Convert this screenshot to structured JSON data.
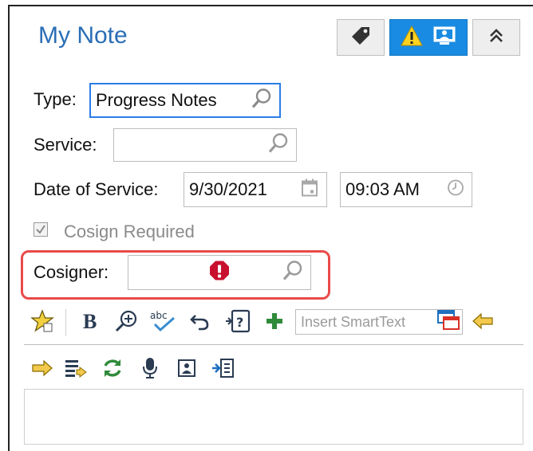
{
  "header": {
    "title": "My Note",
    "buttons": [
      {
        "icon": "tag-icon",
        "active": false
      },
      {
        "icon": "warning-monitor-icon",
        "active": true
      },
      {
        "icon": "chevrons-up-icon",
        "active": false
      }
    ]
  },
  "form": {
    "type_label": "Type:",
    "type_value": "Progress Notes",
    "service_label": "Service:",
    "service_value": "",
    "date_label": "Date of Service:",
    "date_value": "9/30/2021",
    "time_value": "09:03 AM",
    "cosign_required_label": "Cosign Required",
    "cosign_required_checked": true,
    "cosigner_label": "Cosigner:",
    "cosigner_value": ""
  },
  "toolbar": {
    "smarttext_placeholder": "Insert SmartText",
    "row1_icons": [
      "favorite-star-icon",
      "bold-icon",
      "zoom-in-icon",
      "spellcheck-icon",
      "undo-icon",
      "insert-field-icon",
      "add-plus-icon",
      "smarttext-panel-icon",
      "arrow-left-icon"
    ],
    "row2_icons": [
      "arrow-right-icon",
      "insert-lines-icon",
      "refresh-icon",
      "microphone-icon",
      "image-icon",
      "import-icon"
    ]
  },
  "colors": {
    "accent": "#1a8be2",
    "title": "#2a6db5",
    "error": "#c8102e",
    "highlight": "#ea4a4a"
  }
}
